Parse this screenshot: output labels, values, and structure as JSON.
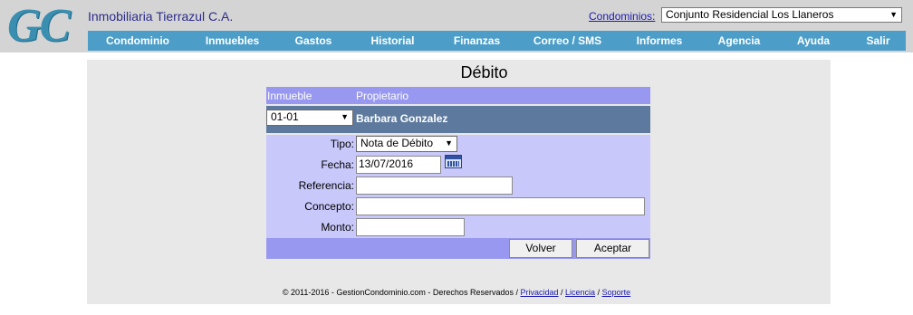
{
  "header": {
    "logo_text": "GC",
    "company": "Inmobiliaria Tierrazul C.A.",
    "condo_label": "Condominios:",
    "condo_selected": "Conjunto Residencial Los Llaneros"
  },
  "nav": [
    "Condominio",
    "Inmuebles",
    "Gastos",
    "Historial",
    "Finanzas",
    "Correo / SMS",
    "Informes",
    "Agencia",
    "Ayuda",
    "Salir"
  ],
  "page": {
    "title": "Débito"
  },
  "owner_table": {
    "col_inmueble": "Inmueble",
    "col_propietario": "Propietario",
    "inmueble_selected": "01-01",
    "propietario": "Barbara Gonzalez"
  },
  "form": {
    "tipo_label": "Tipo:",
    "tipo_value": "Nota de Débito",
    "fecha_label": "Fecha:",
    "fecha_value": "13/07/2016",
    "referencia_label": "Referencia:",
    "referencia_value": "",
    "concepto_label": "Concepto:",
    "concepto_value": "",
    "monto_label": "Monto:",
    "monto_value": ""
  },
  "buttons": {
    "volver": "Volver",
    "aceptar": "Aceptar"
  },
  "footer": {
    "copyright": "© 2011-2016 - GestionCondominio.com - Derechos Reservados /",
    "privacidad": "Privacidad",
    "licencia": "Licencia",
    "soporte": "Soporte"
  },
  "colors": {
    "nav_bg": "#4c9ec9",
    "header_band": "#9898f0",
    "owner_row": "#5d7a9e",
    "form_bg": "#c8c8fa",
    "link": "#1a1ab0"
  }
}
